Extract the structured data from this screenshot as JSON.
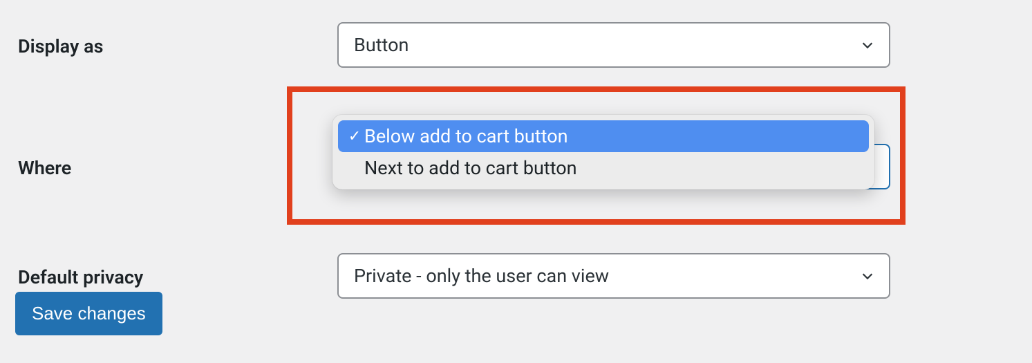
{
  "rows": {
    "display_as": {
      "label": "Display as",
      "value": "Button"
    },
    "where": {
      "label": "Where",
      "value": "Below add to cart button"
    },
    "default_privacy": {
      "label": "Default privacy",
      "value": "Private - only the user can view"
    }
  },
  "where_options": {
    "opt0": "Below add to cart button",
    "opt1": "Next to add to cart button"
  },
  "buttons": {
    "save": "Save changes"
  }
}
